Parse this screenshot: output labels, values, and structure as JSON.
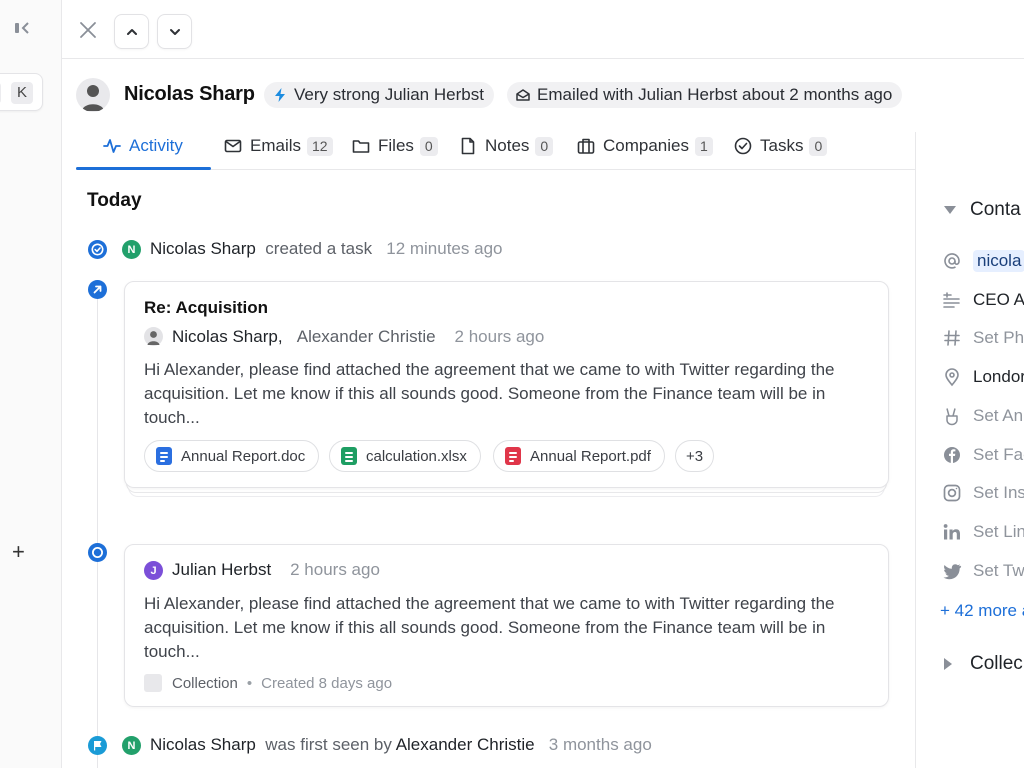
{
  "rail": {
    "shortcut_key": "K",
    "add_label": "+"
  },
  "person": {
    "name": "Nicolas Sharp"
  },
  "chips": {
    "strength": "Very strong Julian Herbst",
    "last_email": "Emailed with Julian Herbst about 2 months ago"
  },
  "tabs": [
    {
      "label": "Activity",
      "count": null,
      "icon": "activity-icon"
    },
    {
      "label": "Emails",
      "count": "12",
      "icon": "mail-icon"
    },
    {
      "label": "Files",
      "count": "0",
      "icon": "folder-icon"
    },
    {
      "label": "Notes",
      "count": "0",
      "icon": "note-icon"
    },
    {
      "label": "Companies",
      "count": "1",
      "icon": "building-icon"
    },
    {
      "label": "Tasks",
      "count": "0",
      "icon": "check-circle-icon"
    }
  ],
  "feed": {
    "day": "Today",
    "task_event": {
      "avatar_letter": "N",
      "actor": "Nicolas Sharp",
      "action": "created a task",
      "time": "12 minutes ago"
    },
    "email_card": {
      "subject": "Re: Acquisition",
      "from": "Nicolas Sharp,",
      "to": "Alexander Christie",
      "time": "2 hours ago",
      "body": "Hi Alexander, please find attached the agreement that we came to with Twitter regarding the acquisition. Let me know if this all sounds good. Someone from the Finance team will be in touch...",
      "attachments": [
        {
          "name": "Annual Report.doc",
          "color": "#2b6fe0"
        },
        {
          "name": "calculation.xlsx",
          "color": "#1e9e63"
        },
        {
          "name": "Annual Report.pdf",
          "color": "#e0364a"
        }
      ],
      "more_attachments": "+3"
    },
    "note_card": {
      "avatar_letter": "J",
      "author": "Julian Herbst",
      "time": "2 hours ago",
      "body": "Hi Alexander, please find attached the agreement that we came to with Twitter regarding the acquisition. Let me know if this all sounds good. Someone from the Finance team will be in touch...",
      "collection": "Collection",
      "separator": "•",
      "created": "Created 8 days ago"
    },
    "seen_event": {
      "avatar_letter": "N",
      "actor": "Nicolas Sharp",
      "action": "was first seen by",
      "by": "Alexander Christie",
      "time": "3 months ago"
    }
  },
  "right_panel": {
    "section_contact": "Conta",
    "email": "nicola",
    "job_title": "CEO At",
    "phone_placeholder": "Set Pho",
    "location": "Londor",
    "angellist_placeholder": "Set An",
    "facebook_placeholder": "Set Fac",
    "instagram_placeholder": "Set Ins",
    "linkedin_placeholder": "Set Lin",
    "twitter_placeholder": "Set Tw",
    "more_link": "+ 42 more a",
    "section_collections": "Collec"
  },
  "colors": {
    "accent": "#1d6fd8",
    "green": "#22a06b",
    "purple": "#7b4fd8"
  }
}
